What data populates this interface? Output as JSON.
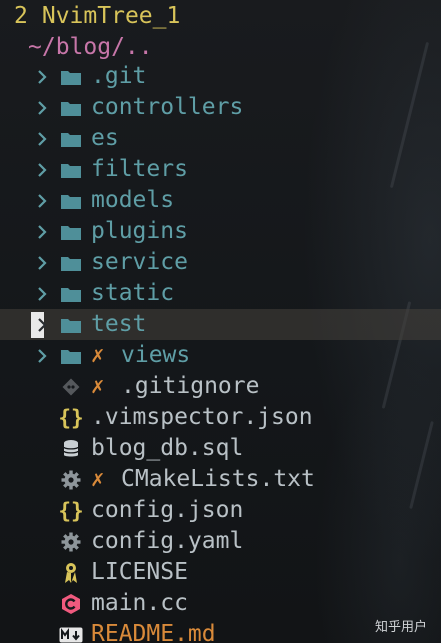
{
  "titlebar": {
    "buffer_number": "2",
    "title": "NvimTree_1"
  },
  "root": {
    "path": "~/blog/.."
  },
  "colors": {
    "folder": "#4f8f99",
    "dir_text": "#5f9ea6",
    "file_text": "#b9c1c6",
    "json_icon": "#d8c45a",
    "git_dirty": "#d98a3a",
    "root_path": "#c776a9",
    "title": "#d8c45a"
  },
  "tree": {
    "items": [
      {
        "name": ".git",
        "type": "folder",
        "icon": "folder-icon"
      },
      {
        "name": "controllers",
        "type": "folder",
        "icon": "folder-icon"
      },
      {
        "name": "es",
        "type": "folder",
        "icon": "folder-icon"
      },
      {
        "name": "filters",
        "type": "folder",
        "icon": "folder-icon"
      },
      {
        "name": "models",
        "type": "folder",
        "icon": "folder-icon"
      },
      {
        "name": "plugins",
        "type": "folder",
        "icon": "folder-icon"
      },
      {
        "name": "service",
        "type": "folder",
        "icon": "folder-icon"
      },
      {
        "name": "static",
        "type": "folder",
        "icon": "folder-icon"
      },
      {
        "name": "test",
        "type": "folder",
        "icon": "folder-icon",
        "cursor": true
      },
      {
        "name": "views",
        "type": "folder",
        "icon": "folder-icon",
        "git_status": "✗"
      },
      {
        "name": ".gitignore",
        "type": "file",
        "icon": "git-icon",
        "git_status": "✗"
      },
      {
        "name": ".vimspector.json",
        "type": "file",
        "icon": "json-icon"
      },
      {
        "name": "blog_db.sql",
        "type": "file",
        "icon": "database-icon"
      },
      {
        "name": "CMakeLists.txt",
        "type": "file",
        "icon": "gear-icon",
        "git_status": "✗"
      },
      {
        "name": "config.json",
        "type": "file",
        "icon": "json-icon"
      },
      {
        "name": "config.yaml",
        "type": "file",
        "icon": "gear-icon"
      },
      {
        "name": "LICENSE",
        "type": "file",
        "icon": "license-icon"
      },
      {
        "name": "main.cc",
        "type": "file",
        "icon": "cpp-icon"
      },
      {
        "name": "README.md",
        "type": "file",
        "icon": "markdown-icon"
      }
    ]
  },
  "watermark": "知乎用户"
}
